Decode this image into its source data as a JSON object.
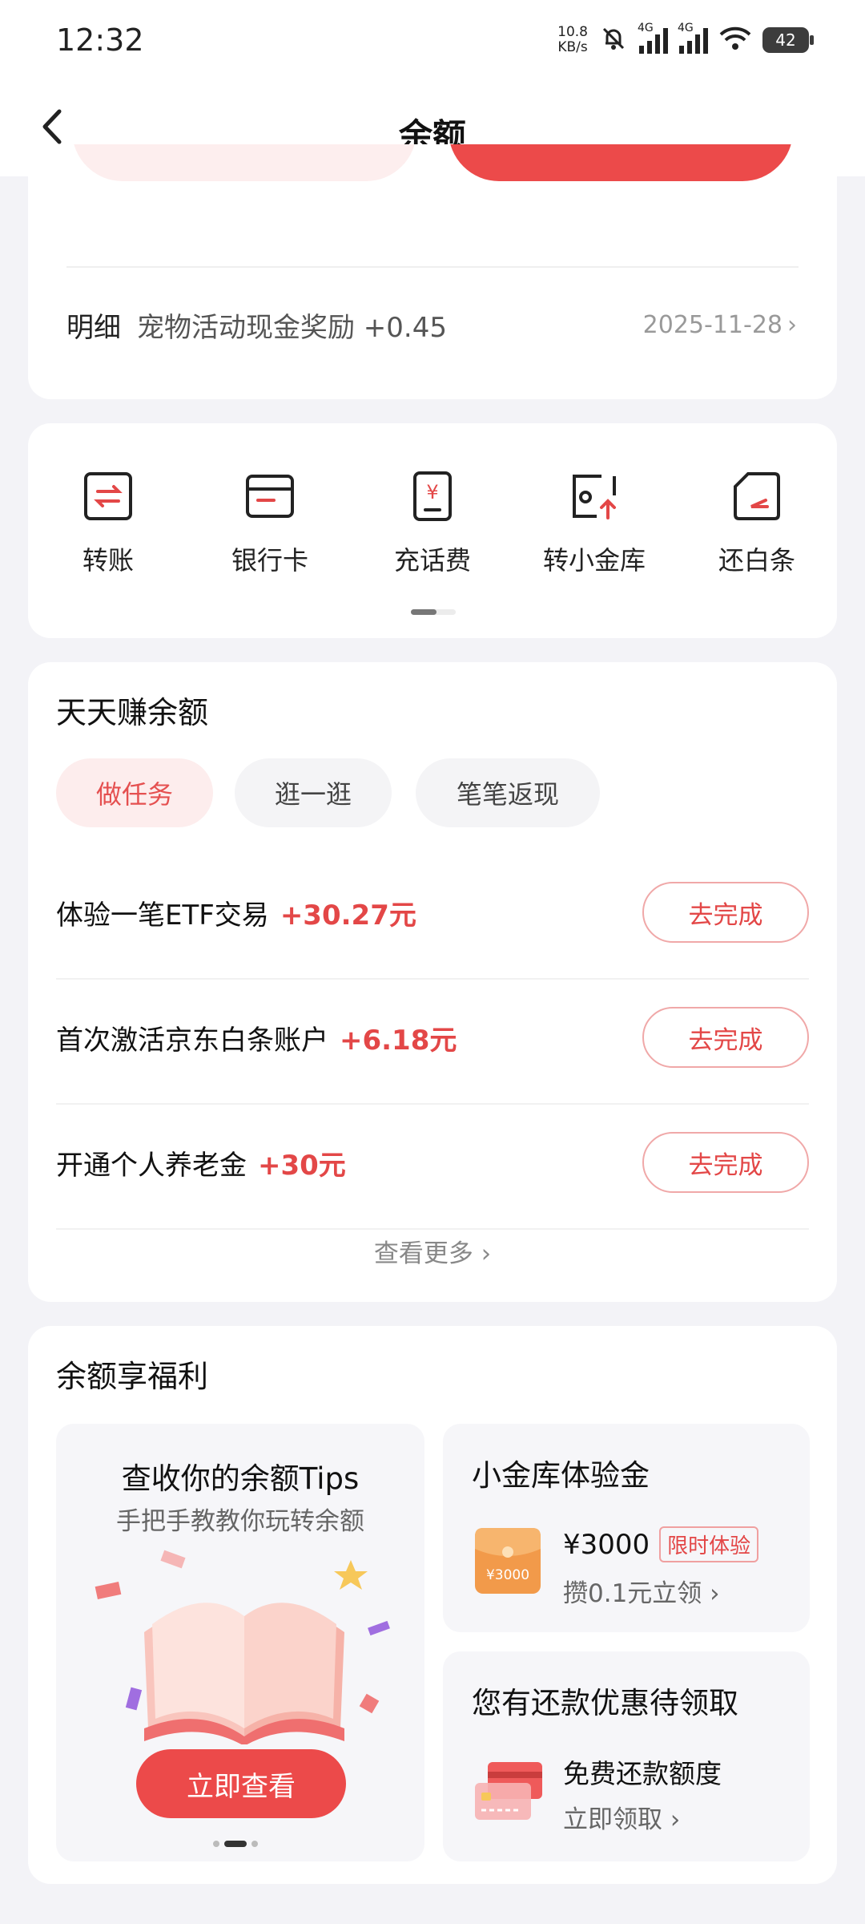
{
  "status": {
    "time": "12:32",
    "net_speed_value": "10.8",
    "net_speed_unit": "KB/s",
    "signal_tag_1": "4G",
    "signal_tag_2": "4G",
    "battery": "42"
  },
  "header": {
    "title": "余额"
  },
  "detail": {
    "label": "明细",
    "text": "宠物活动现金奖励 +0.45",
    "date": "2025-11-28"
  },
  "quick_actions": [
    {
      "label": "转账",
      "icon": "transfer-icon"
    },
    {
      "label": "银行卡",
      "icon": "bank-card-icon"
    },
    {
      "label": "充话费",
      "icon": "phone-recharge-icon"
    },
    {
      "label": "转小金库",
      "icon": "vault-transfer-icon"
    },
    {
      "label": "还白条",
      "icon": "repay-icon"
    }
  ],
  "earn": {
    "title": "天天赚余额",
    "tabs": [
      "做任务",
      "逛一逛",
      "笔笔返现"
    ],
    "active_tab": 0,
    "tasks": [
      {
        "name": "体验一笔ETF交易",
        "reward": "+30.27元",
        "button": "去完成"
      },
      {
        "name": "首次激活京东白条账户",
        "reward": "+6.18元",
        "button": "去完成"
      },
      {
        "name": "开通个人养老金",
        "reward": "+30元",
        "button": "去完成"
      }
    ],
    "see_more": "查看更多"
  },
  "benefits": {
    "title": "余额享福利",
    "tips": {
      "title": "查收你的余额Tips",
      "subtitle": "手把手教教你玩转余额",
      "button": "立即查看"
    },
    "vault": {
      "title": "小金库体验金",
      "amount": "¥3000",
      "badge": "限时体验",
      "sub": "攒0.1元立领",
      "envelope_text": "¥3000"
    },
    "repay": {
      "title": "您有还款优惠待领取",
      "line1": "免费还款额度",
      "line2": "立即领取"
    }
  },
  "colors": {
    "accent": "#ec4a4a",
    "background": "#f3f3f7"
  }
}
